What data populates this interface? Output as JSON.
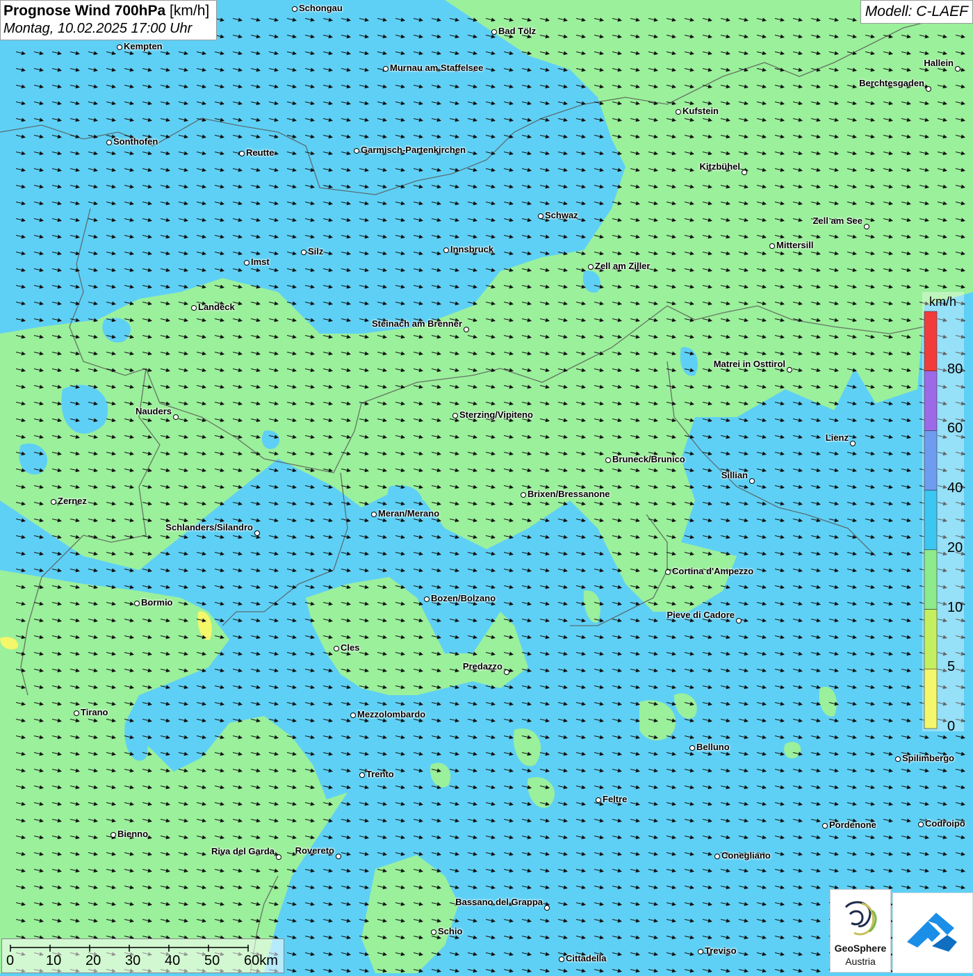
{
  "header": {
    "title_bold": "Prognose Wind 700hPa",
    "title_unit": " [km/h]",
    "subtitle": "Montag, 10.02.2025 17:00 Uhr"
  },
  "model": {
    "label": "Modell: C-LAEF"
  },
  "colors": {
    "water_blue": "#5fd0f5",
    "green_fill": "#9bf09b",
    "yellow_fill": "#f4f76a"
  },
  "legend": {
    "unit": "km/h",
    "ticks": [
      "80",
      "60",
      "40",
      "20",
      "10",
      "5",
      "0"
    ],
    "colors": [
      "#f23b3b",
      "#9c6ae8",
      "#6e9cf0",
      "#3cc6f2",
      "#8ceb8c",
      "#c4f060",
      "#f4f76a"
    ]
  },
  "scalebar": {
    "labels": [
      "0",
      "10",
      "20",
      "30",
      "40",
      "50",
      "60km"
    ]
  },
  "cities": [
    {
      "name": "Schongau"
    },
    {
      "name": "Bad Tölz"
    },
    {
      "name": "Kempten"
    },
    {
      "name": "Murnau am Staffelsee"
    },
    {
      "name": "Hallein"
    },
    {
      "name": "Berchtesgaden"
    },
    {
      "name": "Kufstein"
    },
    {
      "name": "Sonthofen"
    },
    {
      "name": "Reutte"
    },
    {
      "name": "Garmisch-Partenkirchen"
    },
    {
      "name": "Kitzbühel"
    },
    {
      "name": "Schwaz"
    },
    {
      "name": "Zell am See"
    },
    {
      "name": "Mittersill"
    },
    {
      "name": "Silz"
    },
    {
      "name": "Innsbruck"
    },
    {
      "name": "Imst"
    },
    {
      "name": "Zell am Ziller"
    },
    {
      "name": "Landeck"
    },
    {
      "name": "Steinach am Brenner"
    },
    {
      "name": "Matrei in Osttirol"
    },
    {
      "name": "Nauders"
    },
    {
      "name": "Sterzing/Vipiteno"
    },
    {
      "name": "Lienz"
    },
    {
      "name": "Bruneck/Brunico"
    },
    {
      "name": "Sillian"
    },
    {
      "name": "Zernez"
    },
    {
      "name": "Brixen/Bressanone"
    },
    {
      "name": "Meran/Merano"
    },
    {
      "name": "Schlanders/Silandro"
    },
    {
      "name": "Cortina d'Ampezzo"
    },
    {
      "name": "Bozen/Bolzano"
    },
    {
      "name": "Bormio"
    },
    {
      "name": "Pieve di Cadore"
    },
    {
      "name": "Cles"
    },
    {
      "name": "Predazzo"
    },
    {
      "name": "Tirano"
    },
    {
      "name": "Mezzolombardo"
    },
    {
      "name": "Belluno"
    },
    {
      "name": "Spilimbergo"
    },
    {
      "name": "Trento"
    },
    {
      "name": "Feltre"
    },
    {
      "name": "Pordenone"
    },
    {
      "name": "Codroipo"
    },
    {
      "name": "Bienno"
    },
    {
      "name": "Riva del Garda"
    },
    {
      "name": "Rovereto"
    },
    {
      "name": "Conegliano"
    },
    {
      "name": "Bassano del Grappa"
    },
    {
      "name": "Schio"
    },
    {
      "name": "Treviso"
    },
    {
      "name": "Cittadella"
    }
  ],
  "logos": {
    "geosphere_name": "GeoSphere",
    "geosphere_sub": "Austria"
  }
}
